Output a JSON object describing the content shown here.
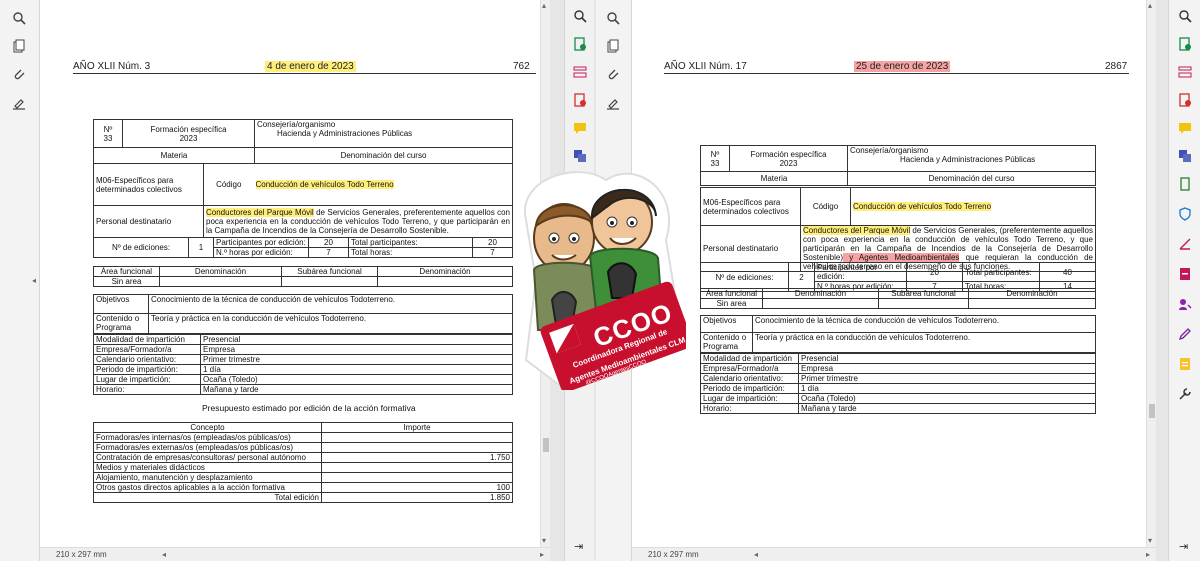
{
  "left_doc": {
    "header": {
      "journal": "AÑO XLII  Núm. 3",
      "date": "4 de enero de 2023",
      "page_num": "762"
    },
    "n_label": "Nº",
    "n_value": "33",
    "formacion": "Formación específica",
    "year": "2023",
    "consejeria_label": "Consejería/organismo",
    "consejeria_value": "Hacienda y Administraciones Públicas",
    "materia_label": "Materia",
    "denominacion_curso_label": "Denominación del curso",
    "materia_value": "M06-Específicos para determinados colectivos",
    "codigo_label": "Código",
    "curso_value": "Conducción de vehículos Todo Terreno",
    "personal_label": "Personal destinatario",
    "personal_hl": "Conductores del Parque Móvil",
    "personal_rest": " de Servicios Generales, preferentemente aquellos con poca experiencia en la conducción de vehículos Todo Terreno, y que participarán en la Campaña de Incendios de la Consejería de Desarrollo Sostenible.",
    "ediciones_label": "Nº de ediciones:",
    "ediciones_value": "1",
    "part_edicion_label": "Participantes por edición:",
    "part_edicion_value": "20",
    "total_part_label": "Total participantes:",
    "total_part_value": "20",
    "horas_edicion_label": "N.º horas por edición:",
    "horas_edicion_value": "7",
    "total_horas_label": "Total horas:",
    "total_horas_value": "7",
    "area_label": "Área funcional",
    "denominacion_label": "Denominación",
    "subarea_label": "Subárea funcional",
    "denominacion2_label": "Denominación",
    "area_value": "Sin area",
    "objetivos_label": "Objetivos",
    "objetivos_value": "Conocimiento de la técnica de conducción de vehículos Todoterreno.",
    "contenido_label": "Contenido o Programa",
    "contenido_value": "Teoría y práctica en la conducción de vehículos Todoterreno.",
    "details": [
      {
        "label": "Modalidad de impartición",
        "value": "Presencial"
      },
      {
        "label": "Empresa/Formador/a",
        "value": "Empresa"
      },
      {
        "label": "Calendario orientativo:",
        "value": "Primer trimestre"
      },
      {
        "label": "Periodo de impartición:",
        "value": "1 día"
      },
      {
        "label": "Lugar de impartición:",
        "value": "Ocaña (Toledo)"
      },
      {
        "label": "Horario:",
        "value": "Mañana y tarde"
      }
    ],
    "presupuesto_title": "Presupuesto estimado por edición de la acción formativa",
    "concepto_label": "Concepto",
    "importe_label": "Importe",
    "budget": [
      {
        "concepto": "Formadoras/es internas/os (empleadas/os públicas/os)",
        "importe": ""
      },
      {
        "concepto": "Formadoras/es externas/os (empleadas/os públicas/os)",
        "importe": ""
      },
      {
        "concepto": "Contratación de empresas/consultoras/ personal autónomo",
        "importe": "1.750"
      },
      {
        "concepto": "Medios y materiales didácticos",
        "importe": ""
      },
      {
        "concepto": "Alojamiento, manutención y desplazamiento",
        "importe": ""
      },
      {
        "concepto": "Otros gastos directos aplicables a la acción formativa",
        "importe": "100"
      }
    ],
    "total_edicion_label": "Total edición",
    "total_edicion_value": "1.850",
    "page_size": "210 x 297 mm"
  },
  "right_doc": {
    "header": {
      "journal": "AÑO XLII  Núm. 17",
      "date": "25 de enero de 2023",
      "page_num": "2867"
    },
    "n_label": "Nº",
    "n_value": "33",
    "formacion": "Formación específica",
    "year": "2023",
    "consejeria_label": "Consejería/organismo",
    "consejeria_value": "Hacienda y Administraciones Públicas",
    "materia_label": "Materia",
    "denominacion_curso_label": "Denominación del curso",
    "materia_value": "M06-Específicos para determinados colectivos",
    "codigo_label": "Código",
    "curso_value": "Conducción de vehículos Todo Terreno",
    "personal_label": "Personal destinatario",
    "personal_hl": "Conductores del Parque Móvil",
    "personal_mid": " de Servicios Generales, (preferentemente aquellos con poca experiencia en la conducción de vehículos Todo Terreno, y que participarán en la Campaña de Incendios de la Consejería de Desarrollo Sostenible)",
    "personal_pink": " y Agentes Medioambientales",
    "personal_end": " que requieran la conducción de vehículos todo terreno en el desempeño de sus funciones.",
    "ediciones_label": "Nº de ediciones:",
    "ediciones_value": "2",
    "part_edicion_label": "Participantes por edición:",
    "part_edicion_value": "20",
    "total_part_label": "Total participantes:",
    "total_part_value": "40",
    "horas_edicion_label": "N.º horas por edición:",
    "horas_edicion_value": "7",
    "total_horas_label": "Total horas:",
    "total_horas_value": "14",
    "area_label": "Área funcional",
    "denominacion_label": "Denominación",
    "subarea_label": "Subárea funcional",
    "denominacion2_label": "Denominación",
    "area_value": "Sin area",
    "objetivos_label": "Objetivos",
    "objetivos_value": "Conocimiento de la técnica de conducción de vehículos Todoterreno.",
    "contenido_label": "Contenido o Programa",
    "contenido_value": "Teoría y práctica en la conducción de vehículos Todoterreno.",
    "details": [
      {
        "label": "Modalidad de impartición",
        "value": "Presencial"
      },
      {
        "label": "Empresa/Formador/a",
        "value": "Empresa"
      },
      {
        "label": "Calendario orientativo:",
        "value": "Primer trimestre"
      },
      {
        "label": "Periodo de impartición:",
        "value": "1 día"
      },
      {
        "label": "Lugar de impartición:",
        "value": "Ocaña (Toledo)"
      },
      {
        "label": "Horario:",
        "value": "Mañana y tarde"
      }
    ],
    "page_size": "210 x 297 mm"
  },
  "logo": {
    "brand": "CCOO",
    "line1": "Coordinadora Regional de",
    "line2": "Agentes Medioambientales CLM",
    "handle": "@CCOOAgentesCCOO"
  },
  "icons": {
    "left_rail": [
      "search-icon",
      "pages-icon",
      "attachment-icon",
      "signature-icon"
    ],
    "right_rail": [
      "zoom-icon",
      "export-pdf-icon",
      "organize-icon",
      "edit-pdf-icon",
      "comment-icon",
      "translate-icon",
      "compress-icon",
      "protect-icon",
      "fill-sign-icon",
      "create-pdf-icon",
      "share-icon",
      "edit-icon",
      "fill-icon",
      "tools-icon"
    ]
  },
  "colors": {
    "highlight_yellow": "#ffef7a",
    "highlight_pink": "#f6a3a3",
    "rail_bg": "#f3f3f3"
  }
}
